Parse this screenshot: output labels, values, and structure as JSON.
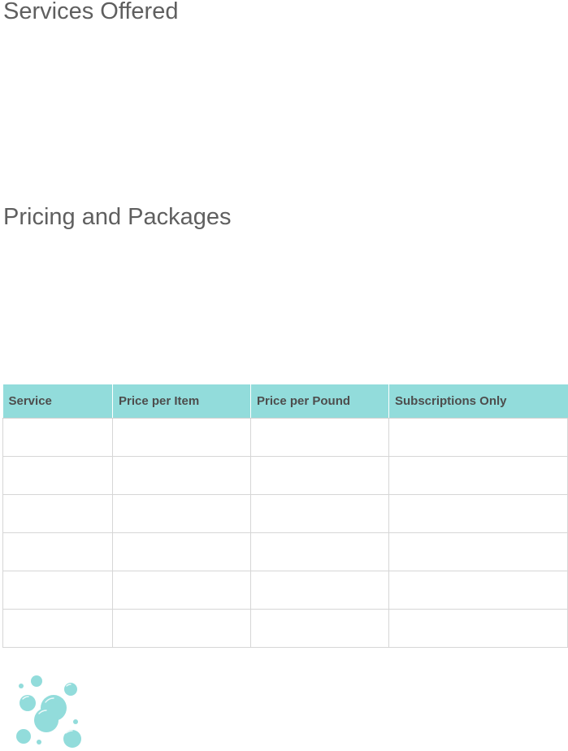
{
  "sections": {
    "services_title": "Services Offered",
    "pricing_title": "Pricing and Packages"
  },
  "pricing_table": {
    "headers": [
      "Service",
      "Price per Item",
      "Price per Pound",
      "Subscriptions Only"
    ],
    "rows": [
      [
        "",
        "",
        "",
        ""
      ],
      [
        "",
        "",
        "",
        ""
      ],
      [
        "",
        "",
        "",
        ""
      ],
      [
        "",
        "",
        "",
        ""
      ],
      [
        "",
        "",
        "",
        ""
      ],
      [
        "",
        "",
        "",
        ""
      ]
    ]
  },
  "colors": {
    "header_fill": "#92dcdb",
    "bubble_color": "#92dcdb",
    "heading_text": "#5f5f5f"
  },
  "decoration": {
    "icon": "bubbles-icon"
  }
}
